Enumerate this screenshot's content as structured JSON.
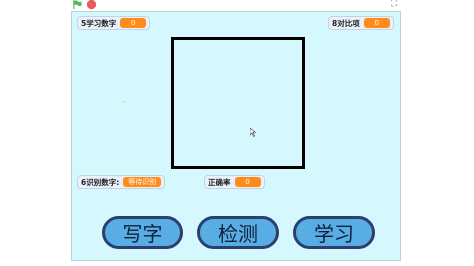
{
  "toolbar": {
    "green_flag_icon": "green-flag-icon",
    "stop_icon": "stop-icon",
    "fullscreen_icon": "⛶"
  },
  "monitors": {
    "learned_count": {
      "label": "5学习数字",
      "value": "0"
    },
    "compare_items": {
      "label": "8对比项",
      "value": "0"
    },
    "recognized": {
      "label": "6识别数字:",
      "value": "等待识别"
    },
    "accuracy": {
      "label": "正确率",
      "value": "0"
    }
  },
  "buttons": {
    "write": "写字",
    "detect": "检测",
    "learn": "学习"
  },
  "colors": {
    "stage_bg": "#d4f8fd",
    "monitor_value": "#ff8c1a",
    "button_fill": "#58aee4",
    "button_border": "#2a3f6b"
  }
}
